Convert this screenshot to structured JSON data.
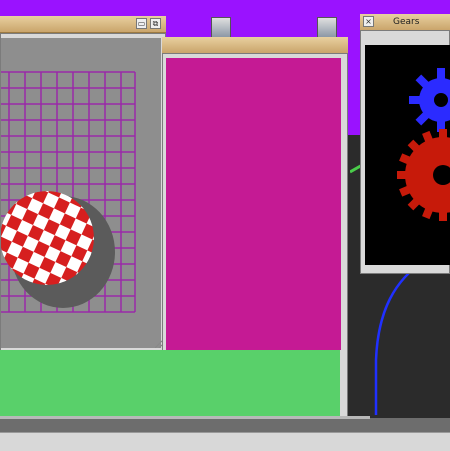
{
  "desktop": {
    "background_color": "#9a12ff",
    "icons": [
      {
        "name": "drive-icon"
      },
      {
        "name": "drive-icon"
      }
    ]
  },
  "windows": {
    "boing": {
      "title": "",
      "ball_colors": {
        "red": "#d61f1f",
        "white": "#ffffff"
      },
      "grid_color": "#9a2aa8",
      "background": "#8e8e8e"
    },
    "color": {
      "title": "",
      "upper_color": "#c51a94",
      "lower_color": "#59d06a"
    },
    "gears": {
      "title": "Gears",
      "close_label": "×",
      "gear_colors": {
        "blue": "#2b2bff",
        "red": "#c71a0a"
      }
    },
    "curve": {
      "line_color": "#2030ff"
    }
  }
}
